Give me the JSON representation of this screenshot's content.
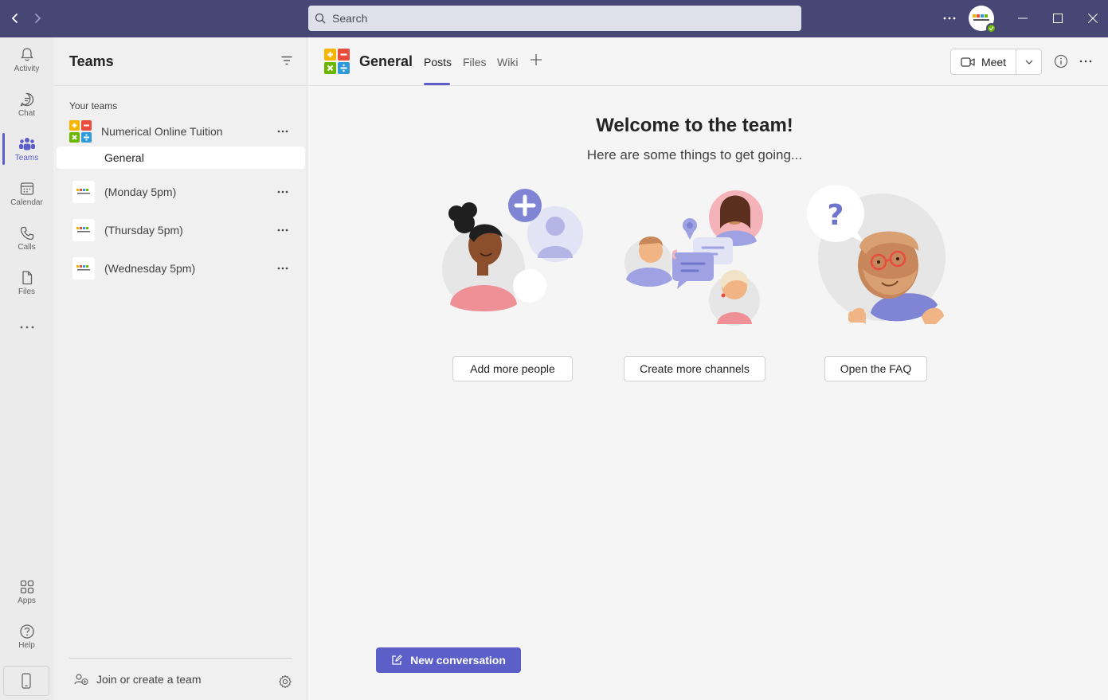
{
  "titlebar": {
    "search_placeholder": "Search",
    "accent": "#464775"
  },
  "rail": {
    "items": [
      {
        "label": "Activity",
        "icon": "bell-icon"
      },
      {
        "label": "Chat",
        "icon": "chat-icon"
      },
      {
        "label": "Teams",
        "icon": "teams-icon"
      },
      {
        "label": "Calendar",
        "icon": "calendar-icon"
      },
      {
        "label": "Calls",
        "icon": "phone-icon"
      },
      {
        "label": "Files",
        "icon": "file-icon"
      }
    ],
    "bottom": [
      {
        "label": "Apps",
        "icon": "apps-icon"
      },
      {
        "label": "Help",
        "icon": "help-icon"
      }
    ]
  },
  "teams_pane": {
    "title": "Teams",
    "section_label": "Your teams",
    "teams": [
      {
        "name": "Numerical Online Tuition",
        "channels": [
          "General"
        ]
      },
      {
        "name": "(Monday 5pm)"
      },
      {
        "name": "(Thursday 5pm)"
      },
      {
        "name": "(Wednesday 5pm)"
      }
    ],
    "join_label": "Join or create a team"
  },
  "main": {
    "channel_title": "General",
    "tabs": [
      "Posts",
      "Files",
      "Wiki"
    ],
    "active_tab": "Posts",
    "meet_label": "Meet",
    "welcome_title": "Welcome to the team!",
    "welcome_subtitle": "Here are some things to get going...",
    "actions": [
      "Add more people",
      "Create more channels",
      "Open the FAQ"
    ],
    "new_conversation_label": "New conversation",
    "brand_color": "#5b5fc7"
  }
}
